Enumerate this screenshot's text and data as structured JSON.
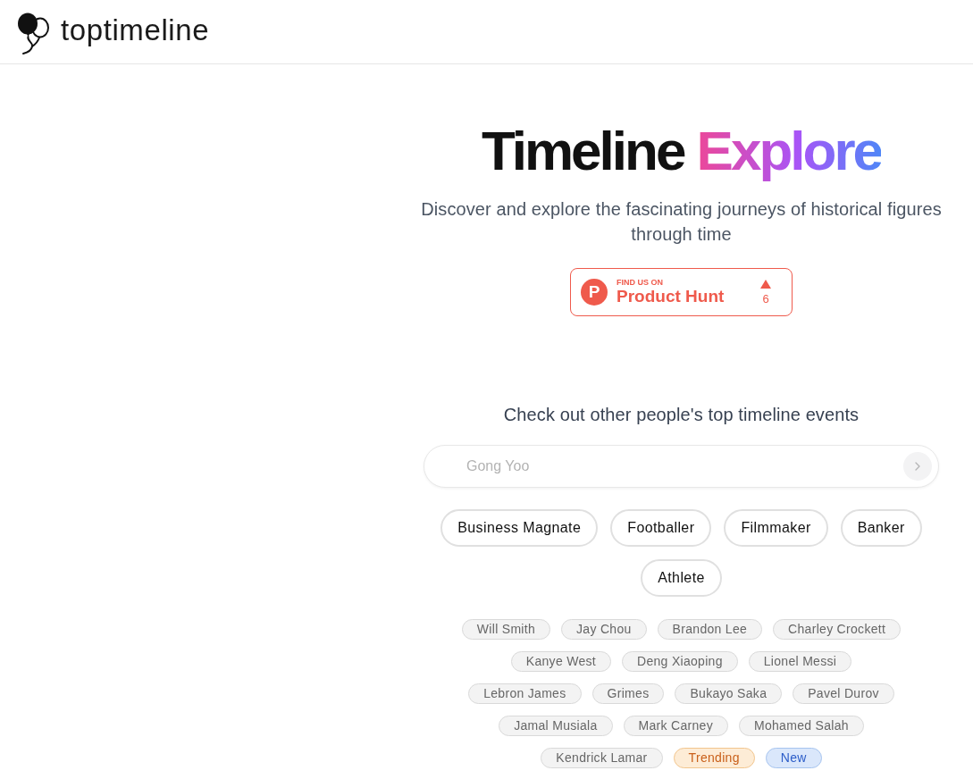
{
  "header": {
    "logo_text": "toptimeline"
  },
  "hero": {
    "title": "Timeline",
    "title_accent": "Explore",
    "subtitle": "Discover and explore the fascinating journeys of historical figures through time"
  },
  "product_hunt_badge": {
    "logo_letter": "P",
    "caption": "FIND US ON",
    "name": "Product Hunt",
    "votes": "6"
  },
  "explore": {
    "heading": "Check out other people's top timeline events",
    "search": {
      "placeholder": "Gong Yoo"
    },
    "categories": [
      "Business Magnate",
      "Footballer",
      "Filmmaker",
      "Banker",
      "Athlete"
    ],
    "tags": [
      {
        "label": "Will Smith",
        "kind": "person"
      },
      {
        "label": "Jay Chou",
        "kind": "person"
      },
      {
        "label": "Brandon Lee",
        "kind": "person"
      },
      {
        "label": "Charley Crockett",
        "kind": "person"
      },
      {
        "label": "Kanye West",
        "kind": "person"
      },
      {
        "label": "Deng Xiaoping",
        "kind": "person"
      },
      {
        "label": "Lionel Messi",
        "kind": "person"
      },
      {
        "label": "Lebron James",
        "kind": "person"
      },
      {
        "label": "Grimes",
        "kind": "person"
      },
      {
        "label": "Bukayo Saka",
        "kind": "person"
      },
      {
        "label": "Pavel Durov",
        "kind": "person"
      },
      {
        "label": "Jamal Musiala",
        "kind": "person"
      },
      {
        "label": "Mark Carney",
        "kind": "person"
      },
      {
        "label": "Mohamed Salah",
        "kind": "person"
      },
      {
        "label": "Kendrick Lamar",
        "kind": "person"
      },
      {
        "label": "Trending",
        "kind": "trending"
      },
      {
        "label": "New",
        "kind": "new"
      }
    ]
  }
}
